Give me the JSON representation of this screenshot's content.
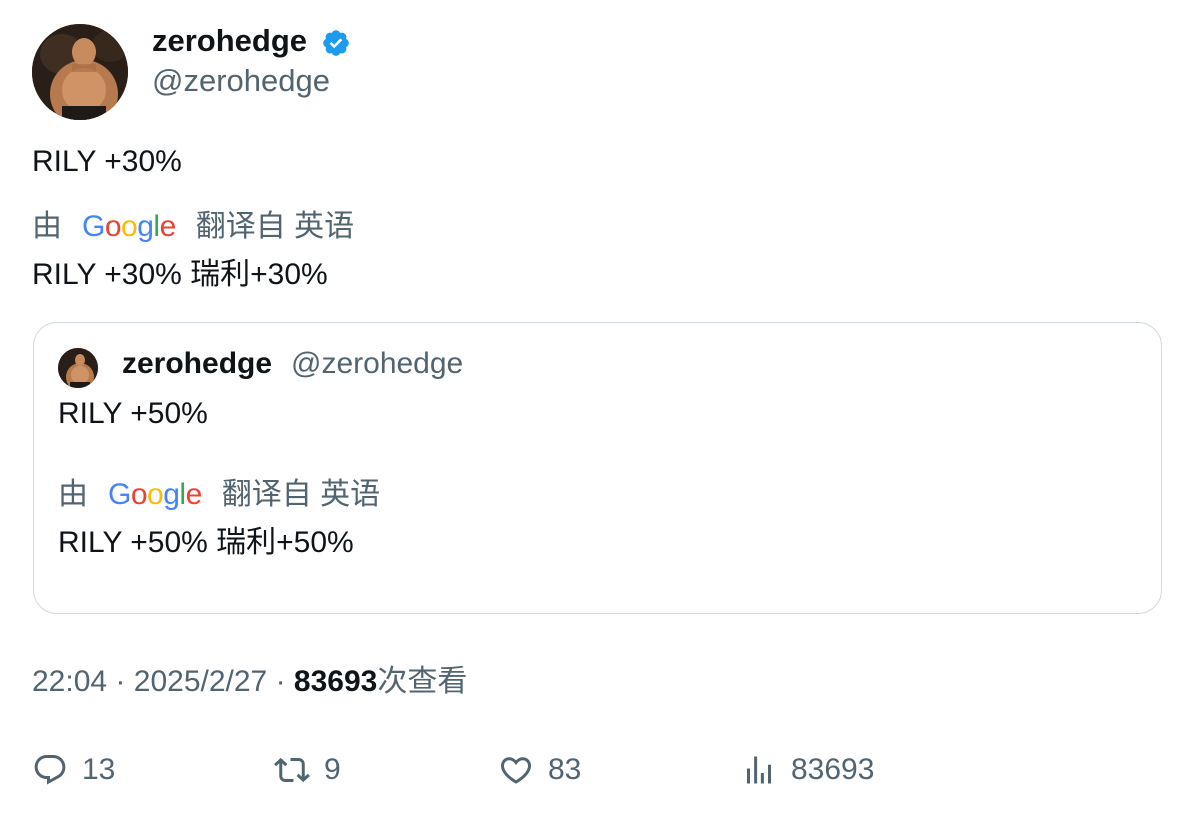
{
  "author": {
    "display_name": "zerohedge",
    "handle": "@zerohedge",
    "verified": true
  },
  "tweet": {
    "text": "RILY +30%",
    "translation": {
      "prefix": "由",
      "provider": "Google",
      "suffix": "翻译自 英语",
      "text": "RILY +30% 瑞利+30%"
    }
  },
  "quoted_tweet": {
    "display_name": "zerohedge",
    "handle": "@zerohedge",
    "text": "RILY +50%",
    "translation": {
      "prefix": "由",
      "provider": "Google",
      "suffix": "翻译自 英语",
      "text": "RILY +50% 瑞利+50%"
    }
  },
  "meta": {
    "time": "22:04",
    "separator": "·",
    "date": "2025/2/27",
    "views_count": "83693",
    "views_label": "次查看"
  },
  "actions": {
    "replies": "13",
    "retweets": "9",
    "likes": "83",
    "views": "83693"
  },
  "colors": {
    "text_primary": "#0f1419",
    "text_secondary": "#536471",
    "verified_blue": "#1d9bf0",
    "border": "#cfd9de",
    "google_blue": "#4285f4",
    "google_red": "#ea4335",
    "google_yellow": "#fbbc05",
    "google_green": "#34a853"
  },
  "icons": {
    "reply": "reply-icon",
    "retweet": "retweet-icon",
    "like": "heart-icon",
    "views": "views-icon",
    "verified": "verified-badge-icon"
  }
}
